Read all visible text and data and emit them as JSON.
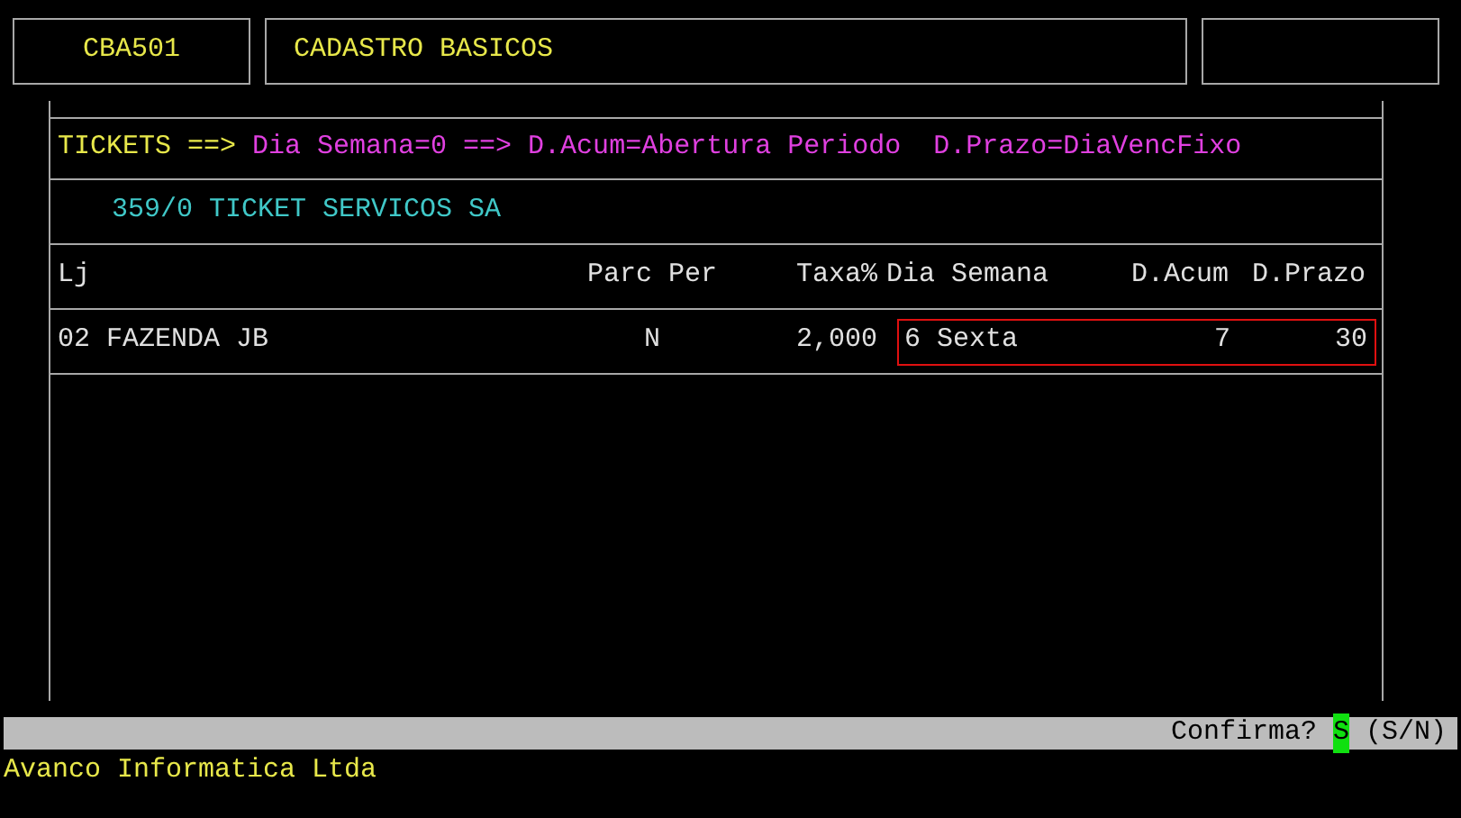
{
  "header": {
    "code": "CBA501",
    "title": "CADASTRO BASICOS"
  },
  "legend": {
    "label": "TICKETS ==>",
    "text": "Dia Semana=0 ==> D.Acum=Abertura Periodo  D.Prazo=DiaVencFixo"
  },
  "company": "359/0 TICKET SERVICOS SA",
  "table": {
    "columns": [
      "Lj",
      "Parc Per",
      "Taxa%",
      "Dia Semana",
      "D.Acum",
      "D.Prazo"
    ],
    "rows": [
      {
        "store": "02 FAZENDA JB",
        "parc_per": "N",
        "taxa": "2,000",
        "dia_semana": "6 Sexta",
        "d_acum": "7",
        "d_prazo": "30",
        "editing": true
      }
    ]
  },
  "status_bar": {
    "prompt": "Confirma?",
    "answer": "S",
    "options": "(S/N)"
  },
  "footer": "Avanco Informatica Ltda"
}
